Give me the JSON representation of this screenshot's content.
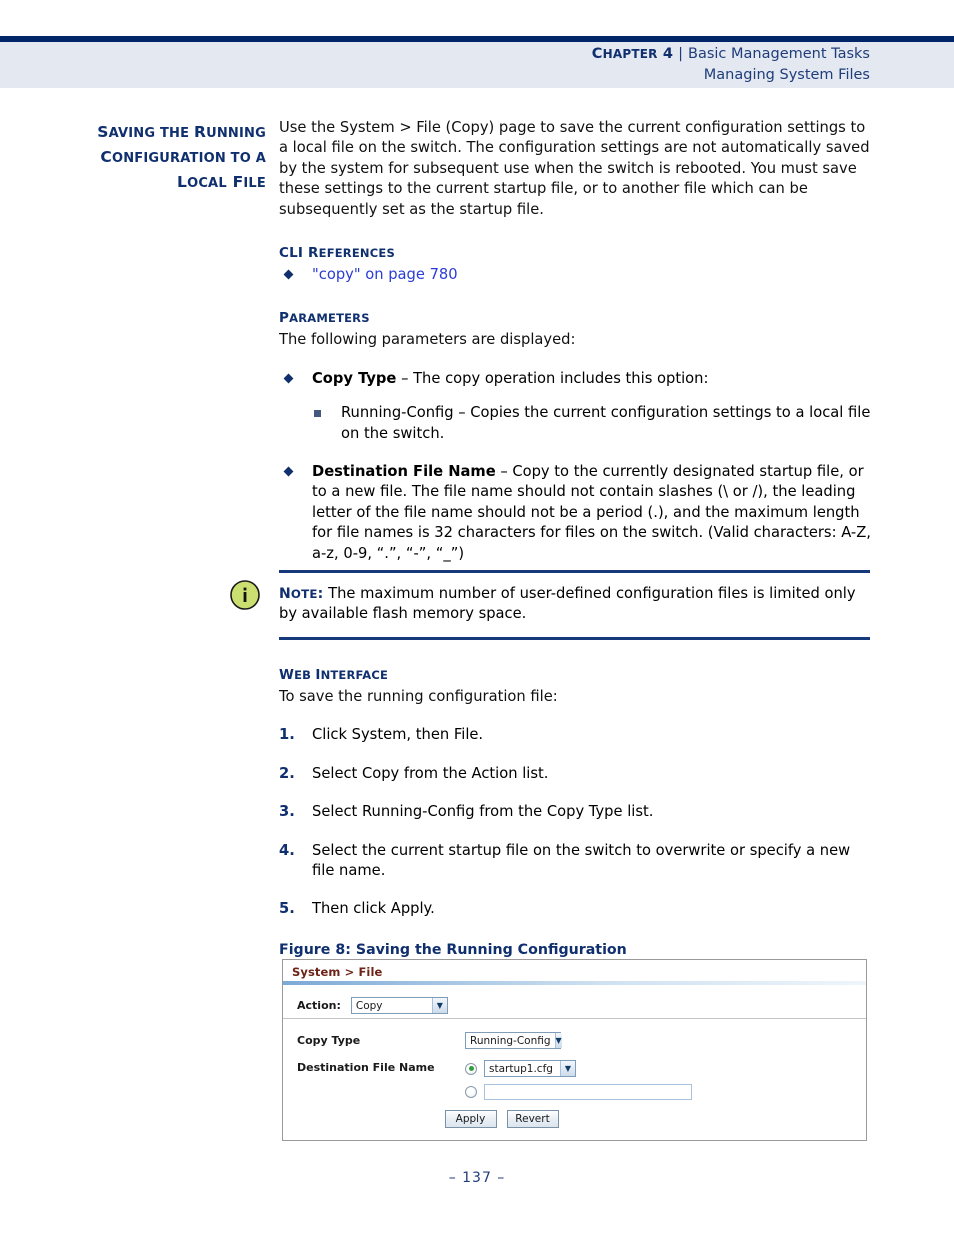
{
  "header": {
    "chapter_label_cap": "C",
    "chapter_label_rest": "HAPTER",
    "chapter_number": "4",
    "separator": "|",
    "chapter_title": "Basic Management Tasks",
    "section_title": "Managing System Files"
  },
  "side_heading": {
    "line1_cap1": "S",
    "line1_a": "AVING",
    "line1_b": " THE ",
    "line1_cap2": "R",
    "line1_c": "UNNING",
    "line2_cap1": "C",
    "line2_a": "ONFIGURATION",
    "line2_b": " TO A",
    "line3_cap1": "L",
    "line3_a": "OCAL",
    "line3_cap2": "F",
    "line3_b": "ILE"
  },
  "intro_paragraph": "Use the System > File (Copy) page to save the current configuration settings to a local file on the switch. The configuration settings are not automatically saved by the system for subsequent use when the switch is rebooted. You must save these settings to the current startup file, or to another file which can be subsequently set as the startup file.",
  "cli_references": {
    "heading_cap": "CLI R",
    "heading_rest": "EFERENCES",
    "items": [
      "\"copy\" on page 780"
    ]
  },
  "parameters": {
    "heading_cap": "P",
    "heading_rest": "ARAMETERS",
    "intro": "The following parameters are displayed:",
    "items": [
      {
        "label": "Copy Type",
        "text": " – The copy operation includes this option:",
        "subitems": [
          "Running-Config – Copies the current configuration settings to a local file on the switch."
        ]
      },
      {
        "label": "Destination File Name",
        "text": " – Copy to the currently designated startup file, or to a new file. The file name should not contain slashes (\\ or /), the leading letter of the file name should not be a period (.), and the maximum length for file names is 32 characters for files on the switch. (Valid characters: A-Z, a-z, 0-9, “.”, “-”, “_”)",
        "subitems": []
      }
    ]
  },
  "note": {
    "keyword_cap": "N",
    "keyword_rest": "OTE",
    "keyword_colon": ":",
    "text": " The maximum number of user-defined configuration files is limited only by available flash memory space.",
    "icon": "info-icon",
    "icon_fill": "#cadf70"
  },
  "web_interface": {
    "heading_cap1": "W",
    "heading_a": "EB ",
    "heading_cap2": "I",
    "heading_b": "NTERFACE",
    "intro": "To save the running configuration file:",
    "steps": [
      {
        "num": "1.",
        "text": "Click System, then File."
      },
      {
        "num": "2.",
        "text": "Select Copy from the Action list."
      },
      {
        "num": "3.",
        "text": "Select Running-Config from the Copy Type list."
      },
      {
        "num": "4.",
        "text": "Select the current startup file on the switch to overwrite or specify a new file name."
      },
      {
        "num": "5.",
        "text": "Then click Apply."
      }
    ]
  },
  "figure": {
    "caption": "Figure 8:  Saving the Running Configuration",
    "screenshot": {
      "title": "System > File",
      "action_label": "Action:",
      "action_value": "Copy",
      "copy_type_label": "Copy Type",
      "copy_type_value": "Running-Config",
      "destination_label": "Destination File Name",
      "destination_value": "startup1.cfg",
      "destination_new_value": "",
      "apply_label": "Apply",
      "revert_label": "Revert"
    }
  },
  "footer": {
    "page_number": "–  137  –"
  },
  "colors": {
    "header_rule": "#002569",
    "header_band": "#e4e8f1",
    "heading_navy": "#0f2f6e",
    "link_blue": "#2b3cd6",
    "shot_title_maroon": "#6e2318",
    "radio_green": "#2f9e3e"
  }
}
